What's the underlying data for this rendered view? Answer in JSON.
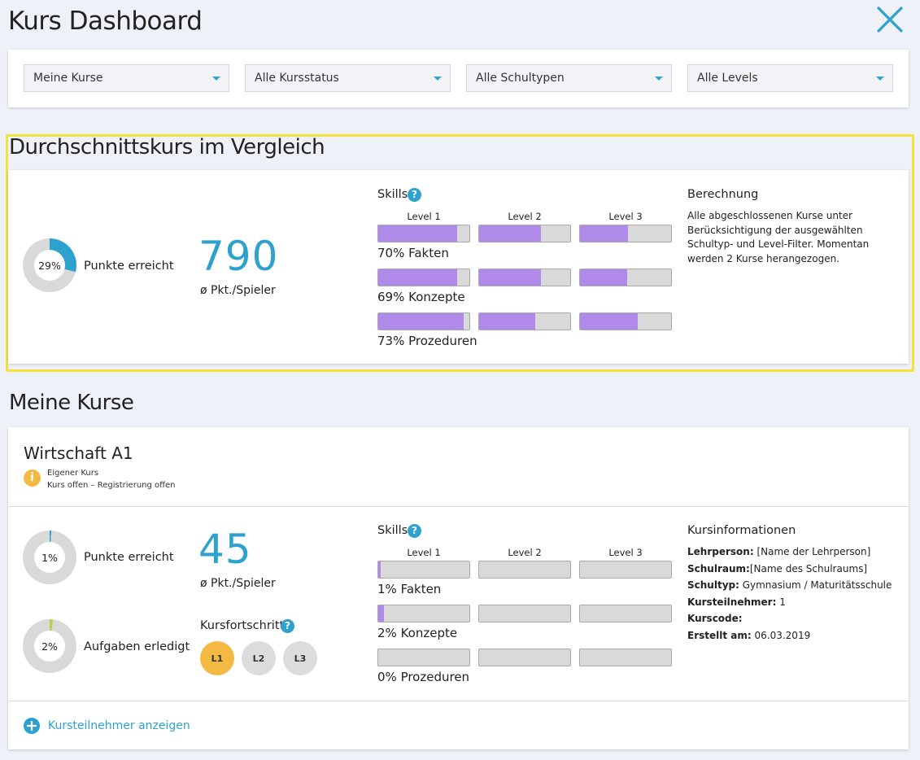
{
  "header": {
    "title": "Kurs Dashboard",
    "close_icon": "close-icon"
  },
  "filters": [
    {
      "label": "Meine Kurse"
    },
    {
      "label": "Alle Kursstatus"
    },
    {
      "label": "Alle Schultypen"
    },
    {
      "label": "Alle Levels"
    }
  ],
  "average": {
    "title": "Durchschnittskurs im Vergleich",
    "points_percent": 29,
    "points_percent_label": "29%",
    "points_label": "Punkte erreicht",
    "avg_points": "790",
    "avg_points_label": "ø Pkt./Spieler",
    "skills_title": "Skills",
    "levels": [
      "Level 1",
      "Level 2",
      "Level 3"
    ],
    "skills": [
      {
        "name": "70% Fakten",
        "fills": [
          0.87,
          0.68,
          0.53
        ]
      },
      {
        "name": "69% Konzepte",
        "fills": [
          0.87,
          0.68,
          0.52
        ]
      },
      {
        "name": "73% Prozeduren",
        "fills": [
          0.94,
          0.62,
          0.63
        ]
      }
    ],
    "calc_title": "Berechnung",
    "calc_text": "Alle abgeschlossenen Kurse unter Berücksichtigung der ausgewählten Schultyp- und Level-Filter. Momentan werden 2 Kurse herangezogen."
  },
  "my_courses": {
    "title": "Meine Kurse",
    "course": {
      "name": "Wirtschaft A1",
      "status_line1": "Eigener Kurs",
      "status_line2": "Kurs offen – Registrierung offen",
      "points_percent": 1,
      "points_percent_label": "1%",
      "points_label": "Punkte erreicht",
      "tasks_percent": 2,
      "tasks_percent_label": "2%",
      "tasks_label": "Aufgaben erledigt",
      "avg_points": "45",
      "avg_points_label": "ø Pkt./Spieler",
      "progress_title": "Kursfortschritt",
      "progress_levels": [
        {
          "label": "L1",
          "active": true
        },
        {
          "label": "L2",
          "active": false
        },
        {
          "label": "L3",
          "active": false
        }
      ],
      "skills_title": "Skills",
      "levels": [
        "Level 1",
        "Level 2",
        "Level 3"
      ],
      "skills": [
        {
          "name": "1% Fakten",
          "fills": [
            0.03,
            0,
            0
          ]
        },
        {
          "name": "2% Konzepte",
          "fills": [
            0.06,
            0,
            0
          ]
        },
        {
          "name": "0% Prozeduren",
          "fills": [
            0,
            0,
            0
          ]
        }
      ],
      "info_title": "Kursinformationen",
      "info": [
        {
          "key": "Lehrperson:",
          "value": " [Name der Lehrperson]"
        },
        {
          "key": "Schulraum:",
          "value": "[Name des Schulraums]"
        },
        {
          "key": "Schultyp:",
          "value": " Gymnasium / Maturitätsschule"
        },
        {
          "key": "Kursteilnehmer:",
          "value": " 1"
        },
        {
          "key": "Kurscode:",
          "value": ""
        },
        {
          "key": "Erstellt am:",
          "value": " 06.03.2019"
        }
      ],
      "show_participants": "Kursteilnehmer anzeigen"
    }
  },
  "colors": {
    "accent": "#2ea2cf",
    "skill_fill": "#b08ae8",
    "highlight": "#f2e43c",
    "level_active": "#f4b942",
    "info": "#f4b942",
    "tasks": "#b7d24b"
  }
}
